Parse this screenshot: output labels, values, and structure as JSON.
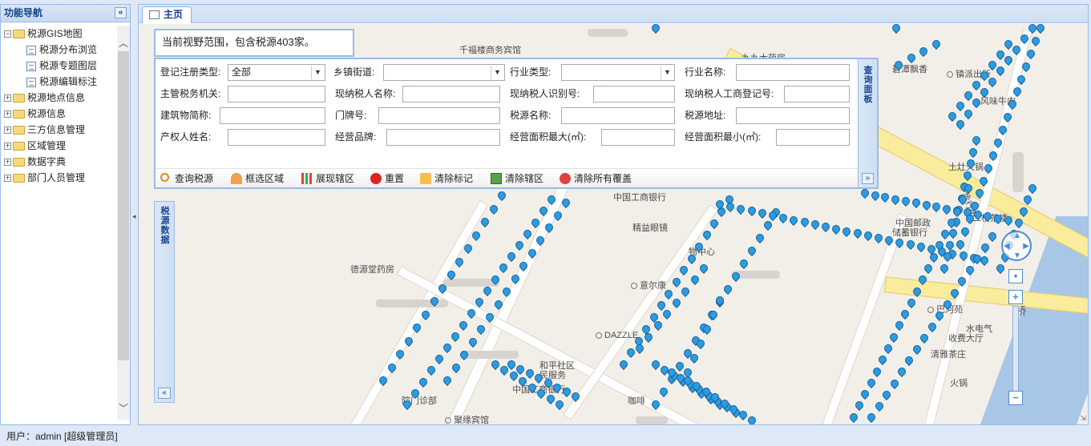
{
  "sidebar": {
    "title": "功能导航",
    "collapse_icon": "«",
    "tree": [
      {
        "label": "税源GIS地图",
        "toggle": "−",
        "children": [
          "税源分布浏览",
          "税源专题图层",
          "税源编辑标注"
        ]
      },
      {
        "label": "税源地点信息",
        "toggle": "+"
      },
      {
        "label": "税源信息",
        "toggle": "+"
      },
      {
        "label": "三方信息管理",
        "toggle": "+"
      },
      {
        "label": "区域管理",
        "toggle": "+"
      },
      {
        "label": "数据字典",
        "toggle": "+"
      },
      {
        "label": "部门人员管理",
        "toggle": "+"
      }
    ]
  },
  "tabs": [
    {
      "label": "主页"
    }
  ],
  "count_text": "当前视野范围，包含税源403家。",
  "query": {
    "side_title": "查询面板",
    "expand_icon": "»",
    "fields": {
      "reg_type": {
        "label": "登记注册类型:",
        "value": "全部"
      },
      "street": {
        "label": "乡镇街道:",
        "value": ""
      },
      "industry_type": {
        "label": "行业类型:",
        "value": ""
      },
      "industry_name": {
        "label": "行业名称:",
        "value": ""
      },
      "tax_office": {
        "label": "主管税务机关:",
        "value": ""
      },
      "taxpayer_name": {
        "label": "现纳税人名称:",
        "value": ""
      },
      "taxpayer_id": {
        "label": "现纳税人识别号:",
        "value": ""
      },
      "business_reg": {
        "label": "现纳税人工商登记号:",
        "value": ""
      },
      "building": {
        "label": "建筑物简称:",
        "value": ""
      },
      "door_no": {
        "label": "门牌号:",
        "value": ""
      },
      "source_name": {
        "label": "税源名称:",
        "value": ""
      },
      "source_addr": {
        "label": "税源地址:",
        "value": ""
      },
      "owner": {
        "label": "产权人姓名:",
        "value": ""
      },
      "brand": {
        "label": "经营品牌:",
        "value": ""
      },
      "area_max": {
        "label": "经营面积最大(㎡):",
        "value": ""
      },
      "area_min": {
        "label": "经营面积最小(㎡):",
        "value": ""
      }
    },
    "buttons": {
      "search": "查询税源",
      "box_select": "框选区域",
      "show_district": "展现辖区",
      "reset": "重置",
      "clear_marks": "清除标记",
      "clear_district": "清除辖区",
      "clear_all": "清除所有覆盖"
    }
  },
  "left_panel": {
    "title": "税源数据",
    "expand_icon": "«"
  },
  "map": {
    "pois": [
      "千福楼商务宾馆",
      "九九大药房",
      "碧潭飘香",
      "镇派出所",
      "风味牛肉",
      "中国工商银行",
      "精益眼镜",
      "物中心",
      "意尔康",
      "德源堂药房",
      "DAZZLE",
      "和平社区",
      "民服务",
      "中国工商银行",
      "院门诊部",
      "聚缘宾馆",
      "咖啡",
      "巴河苑",
      "水电气",
      "收费大厅",
      "清雅茶庄",
      "火锅",
      "二桥茶楼",
      "土灶火锅",
      "步行街",
      "桥",
      "中国邮政",
      "储蓄银行"
    ],
    "zoom_in": "+",
    "zoom_out": "−"
  },
  "status": {
    "text": "用户：admin [超级管理员]"
  },
  "colors": {
    "accent": "#15428b",
    "panel_border": "#99bbe8",
    "pin": "#2d9be0"
  }
}
